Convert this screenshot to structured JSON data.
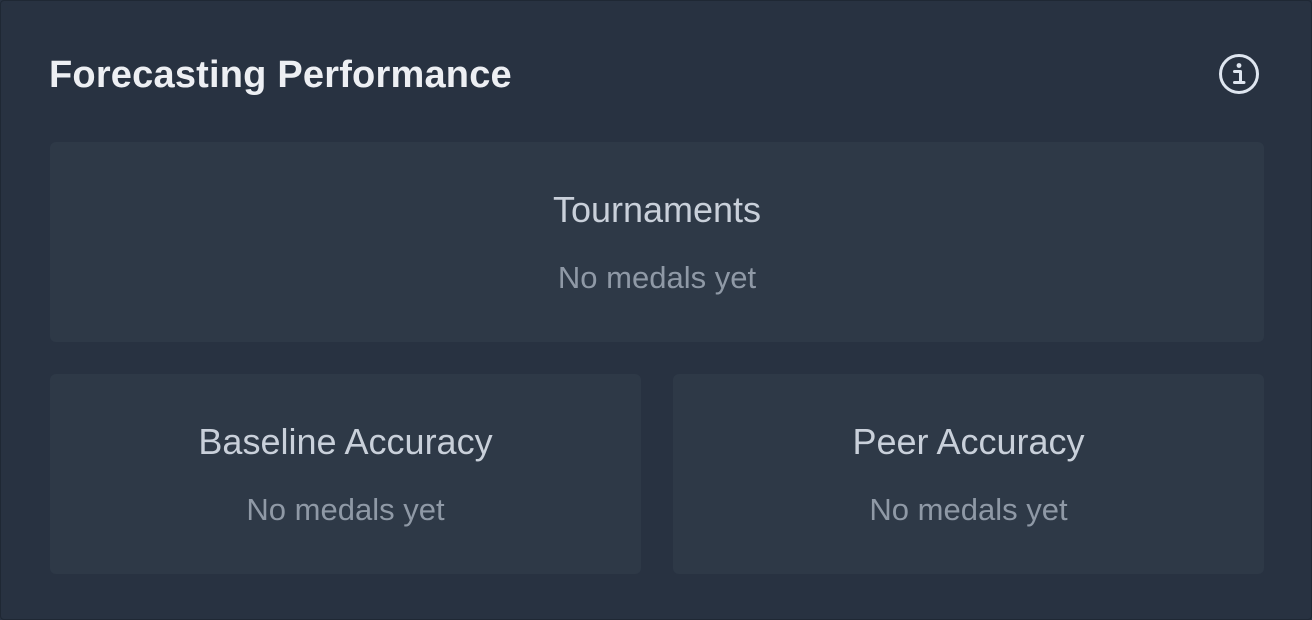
{
  "header": {
    "title": "Forecasting Performance",
    "info_icon": "info-circle-icon"
  },
  "cards": {
    "tournaments": {
      "heading": "Tournaments",
      "status": "No medals yet"
    },
    "baseline": {
      "heading": "Baseline Accuracy",
      "status": "No medals yet"
    },
    "peer": {
      "heading": "Peer Accuracy",
      "status": "No medals yet"
    }
  },
  "colors": {
    "background": "#283241",
    "card": "#2e3947",
    "title": "#edeff3",
    "heading": "#c9d0da",
    "muted": "#8f99a6",
    "icon": "#dfe6f0"
  }
}
